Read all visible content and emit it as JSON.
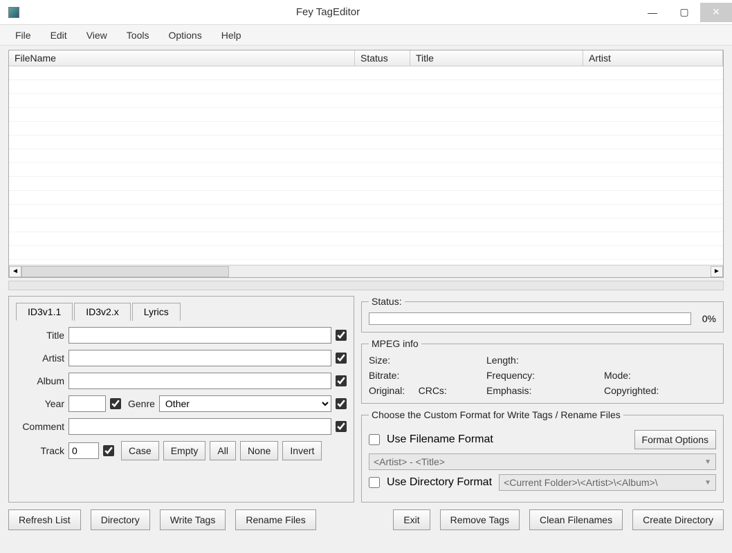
{
  "window": {
    "title": "Fey TagEditor"
  },
  "menu": [
    "File",
    "Edit",
    "View",
    "Tools",
    "Options",
    "Help"
  ],
  "columns": {
    "filename": "FileName",
    "status": "Status",
    "title": "Title",
    "artist": "Artist"
  },
  "tabs": {
    "id3v1": "ID3v1.1",
    "id3v2": "ID3v2.x",
    "lyrics": "Lyrics"
  },
  "labels": {
    "title": "Title",
    "artist": "Artist",
    "album": "Album",
    "year": "Year",
    "genre": "Genre",
    "comment": "Comment",
    "track": "Track"
  },
  "values": {
    "title": "",
    "artist": "",
    "album": "",
    "year": "",
    "comment": "",
    "genre": "Other",
    "track": "0"
  },
  "btns": {
    "case": "Case",
    "empty": "Empty",
    "all": "All",
    "none": "None",
    "invert": "Invert",
    "refresh": "Refresh List",
    "directory": "Directory",
    "writetags": "Write Tags",
    "rename": "Rename Files",
    "exit": "Exit",
    "removetags": "Remove Tags",
    "cleanfn": "Clean Filenames",
    "createdir": "Create Directory",
    "formatopts": "Format Options"
  },
  "status": {
    "legend": "Status:",
    "percent": "0%"
  },
  "mpeg": {
    "legend": "MPEG info",
    "size": "Size:",
    "length": "Length:",
    "bitrate": "Bitrate:",
    "frequency": "Frequency:",
    "mode": "Mode:",
    "original": "Original:",
    "crcs": "CRCs:",
    "emphasis": "Emphasis:",
    "copyrighted": "Copyrighted:"
  },
  "customfmt": {
    "legend": "Choose the Custom Format for Write Tags / Rename Files",
    "usefn": "Use Filename Format",
    "usedir": "Use Directory Format",
    "fnvalue": "<Artist> - <Title>",
    "dirvalue": "<Current Folder>\\<Artist>\\<Album>\\"
  }
}
